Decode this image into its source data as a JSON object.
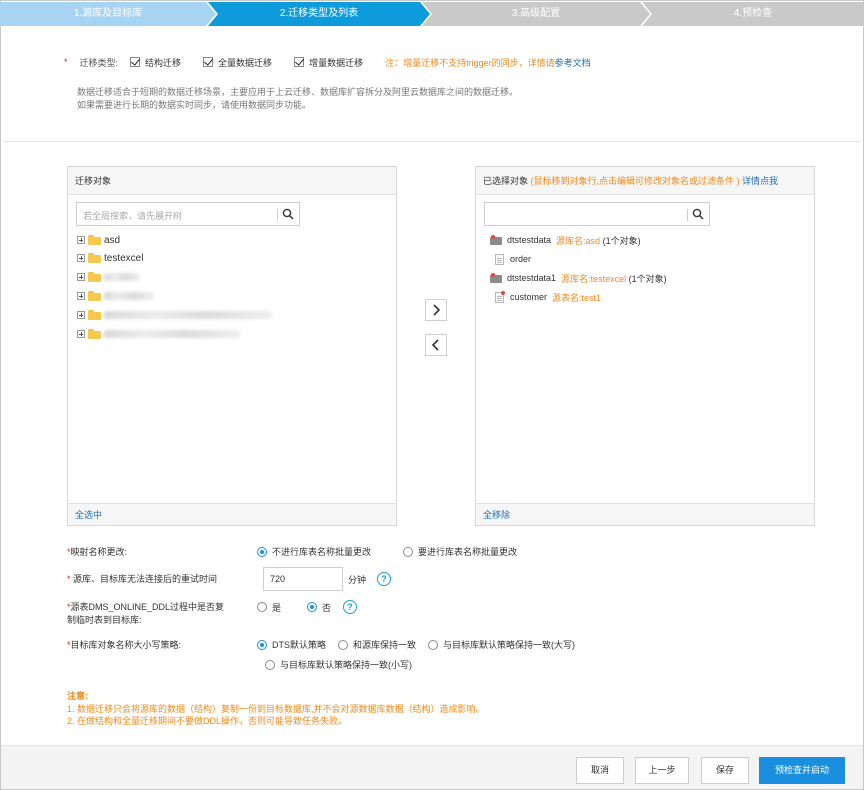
{
  "steps": [
    {
      "label": "1.源库及目标库",
      "state": "done"
    },
    {
      "label": "2.迁移类型及列表",
      "state": "active"
    },
    {
      "label": "3.高级配置",
      "state": "todo"
    },
    {
      "label": "4.预检查",
      "state": "todo"
    }
  ],
  "colors": {
    "step_done": "#a8d4f4",
    "step_active": "#0d9bdc",
    "step_todo": "#c9c9c9",
    "accent": "#1a8fe0",
    "orange": "#f08a1c"
  },
  "migration_type": {
    "required_mark": "*",
    "label": "迁移类型:",
    "options": [
      {
        "label": "结构迁移",
        "checked": true
      },
      {
        "label": "全量数据迁移",
        "checked": true
      },
      {
        "label": "增量数据迁移",
        "checked": true
      }
    ],
    "note": "注：增量迁移不支持trigger的同步，详情请",
    "note_link": "参考文档",
    "desc_line1": "数据迁移适合于短期的数据迁移场景，主要应用于上云迁移、数据库扩容拆分及阿里云数据库之间的数据迁移。",
    "desc_line2": "如果需要进行长期的数据实时同步，请使用数据同步功能。"
  },
  "source_panel": {
    "title": "迁移对象",
    "search_placeholder": "若全局搜索，请先展开树",
    "items": [
      {
        "label": "asd",
        "icon": "folder-icon"
      },
      {
        "label": "testexcel",
        "icon": "folder-icon"
      }
    ],
    "select_all": "全选中"
  },
  "selected_panel": {
    "title": "已选择对象",
    "hint": "(鼠标移到对象行,点击编辑可修改对象名或过滤条件 )",
    "hint_link": "详情点我",
    "items": [
      {
        "name": "dtstestdata",
        "note": "源库名:asd",
        "count": "(1个对象)",
        "icon": "database-icon"
      },
      {
        "name": "order",
        "note": "",
        "count": "",
        "icon": "table-icon"
      },
      {
        "name": "dtstestdata1",
        "note": "源库名:testexcel",
        "count": "(1个对象)",
        "icon": "database-icon"
      },
      {
        "name": "customer",
        "note": "源表名:test1",
        "count": "",
        "icon": "table-icon"
      }
    ],
    "remove_all": "全移除"
  },
  "form": {
    "rename": {
      "label": "映射名称更改:",
      "options": [
        "不进行库表名称批量更改",
        "要进行库表名称批量更改"
      ],
      "selected": 0
    },
    "retry": {
      "label": "源库、目标库无法连接后的重试时间",
      "value": "720",
      "unit": "分钟"
    },
    "ddl": {
      "label_line1": "源表DMS_ONLINE_DDL过程中是否复",
      "label_line2": "制临时表到目标库:",
      "options": [
        "是",
        "否"
      ],
      "selected": 1
    },
    "case": {
      "label": "目标库对象名称大小写策略:",
      "options": [
        "DTS默认策略",
        "和源库保持一致",
        "与目标库默认策略保持一致(大写)",
        "与目标库默认策略保持一致(小写)"
      ],
      "selected": 0
    }
  },
  "notes": {
    "title": "注意:",
    "line1": "1. 数据迁移只会将源库的数据（结构）复制一份到目标数据库,并不会对源数据库数据（结构）造成影响。",
    "line2": "2. 在做结构和全量迁移期间不要做DDL操作，否则可能导致任务失败。"
  },
  "buttons": {
    "cancel": "取消",
    "prev": "上一步",
    "save": "保存",
    "start": "预检查并启动"
  }
}
